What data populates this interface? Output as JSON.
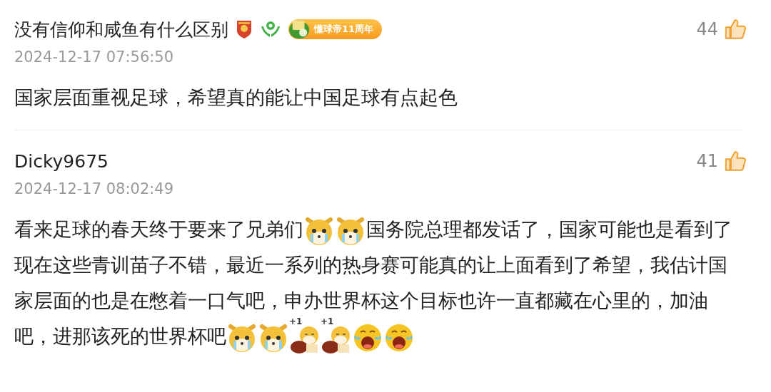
{
  "comments": [
    {
      "username": "没有信仰和咸鱼有什么区别",
      "badges": [
        {
          "kind": "shield"
        },
        {
          "kind": "hands"
        },
        {
          "kind": "anniversary",
          "label": "懂球帝11周年"
        }
      ],
      "time": "2024-12-17 07:56:50",
      "likes": "44",
      "body": [
        {
          "kind": "text",
          "text": "国家层面重视足球，希望真的能让中国足球有点起色"
        }
      ]
    },
    {
      "username": "Dicky9675",
      "time": "2024-12-17 08:02:49",
      "likes": "41",
      "body": [
        {
          "kind": "text",
          "text": "看来足球的春天终于要来了兄弟们"
        },
        {
          "kind": "dog-cry"
        },
        {
          "kind": "dog-cry"
        },
        {
          "kind": "text",
          "text": "国务院总理都发话了，国家可能也是看到了现在这些青训苗子不错，最近一系列的热身赛可能真的让上面看到了希望，我估计国家层面的也是在憋着一口气吧，申办世界杯这个目标也许一直都藏在心里的，加油吧，进那该死的世界杯吧"
        },
        {
          "kind": "dog-cry"
        },
        {
          "kind": "dog-cry"
        },
        {
          "kind": "dog-plus",
          "mark": "+1"
        },
        {
          "kind": "dog-plus",
          "mark": "+1"
        },
        {
          "kind": "cry"
        },
        {
          "kind": "cry"
        }
      ]
    }
  ]
}
